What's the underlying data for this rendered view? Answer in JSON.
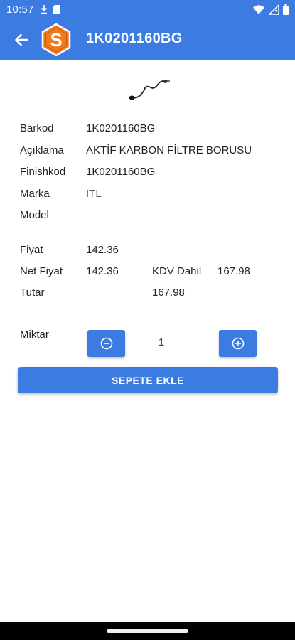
{
  "status_bar": {
    "time": "10:57"
  },
  "header": {
    "title": "1K0201160BG",
    "logo_letter": "S",
    "color": "#3b7be2",
    "logo_color": "#f07a1c"
  },
  "product": {
    "barkod_label": "Barkod",
    "barkod": "1K0201160BG",
    "aciklama_label": "Açıklama",
    "aciklama": "AKTİF KARBON FİLTRE BORUSU",
    "finishkod_label": "Finishkod",
    "finishkod": "1K0201160BG",
    "marka_label": "Marka",
    "marka": "İTL",
    "model_label": "Model",
    "model": ""
  },
  "pricing": {
    "fiyat_label": "Fiyat",
    "fiyat": "142.36",
    "net_fiyat_label": "Net Fiyat",
    "net_fiyat": "142.36",
    "kdv_label": "KDV Dahil",
    "kdv_dahil": "167.98",
    "tutar_label": "Tutar",
    "tutar": "167.98"
  },
  "quantity": {
    "label": "Miktar",
    "value": "1"
  },
  "actions": {
    "add_to_cart": "SEPETE EKLE"
  }
}
